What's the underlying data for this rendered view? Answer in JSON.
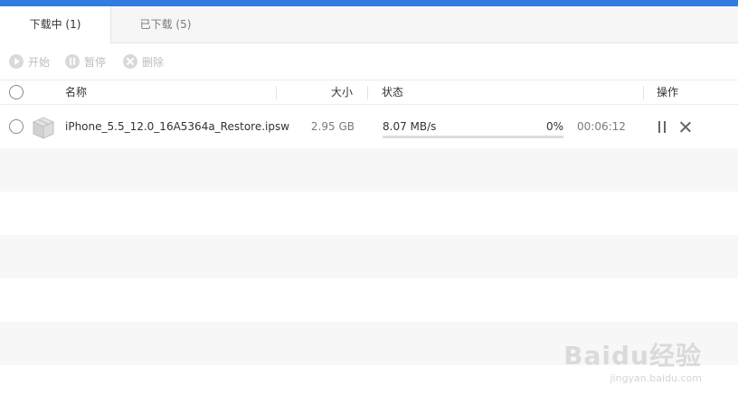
{
  "tabs": [
    {
      "label": "下载中 (1)",
      "active": true
    },
    {
      "label": "已下载 (5)",
      "active": false
    }
  ],
  "toolbar": {
    "start_label": "开始",
    "pause_label": "暂停",
    "delete_label": "删除"
  },
  "table": {
    "columns": {
      "name": "名称",
      "size": "大小",
      "status": "状态",
      "actions": "操作"
    },
    "rows": [
      {
        "filename": "iPhone_5.5_12.0_16A5364a_Restore.ipsw",
        "size": "2.95 GB",
        "speed": "8.07 MB/s",
        "percent": "0%",
        "progress": 0,
        "time_remaining": "00:06:12"
      }
    ]
  },
  "watermark": {
    "brand": "Baidu经验",
    "url": "jingyan.baidu.com"
  },
  "colors": {
    "accent": "#2f7de1",
    "stripe": "#f7f7f7"
  },
  "icons": {
    "file": "file-package-icon",
    "start": "play-icon",
    "pause": "pause-icon",
    "delete": "close-icon"
  }
}
